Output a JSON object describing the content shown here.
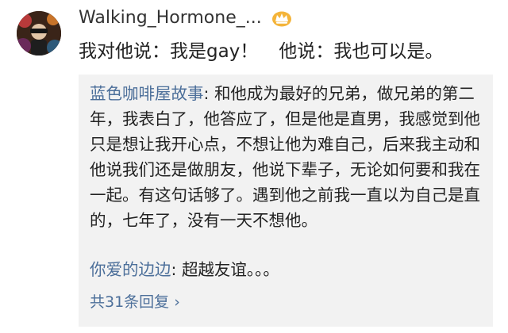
{
  "post": {
    "username": "Walking_Hormone_...",
    "text_part1": "我对他说：我是gay！",
    "text_part2": "他说：我也可以是。",
    "avatar_icon": "profile-avatar",
    "badge_icon": "vip-crown-icon"
  },
  "replies": [
    {
      "author": "蓝色咖啡屋故事",
      "separator": ": ",
      "text": "和他成为最好的兄弟，做兄弟的第二年，我表白了，他答应了，但是他是直男，我感觉到他只是想让我开心点，不想让他为难自己，后来我主动和他说我们还是做朋友，他说下辈子，无论如何要和我在一起。有这句话够了。遇到他之前我一直以为自己是直的，七年了，没有一天不想他。"
    },
    {
      "author": "你爱的边边",
      "separator": ": ",
      "text": "超越友谊。。。"
    }
  ],
  "more_replies_label": "共31条回复",
  "more_replies_chevron": "›",
  "colors": {
    "link_blue": "#4c6f9a",
    "reply_bg": "#f2f2f2",
    "text": "#222222"
  }
}
